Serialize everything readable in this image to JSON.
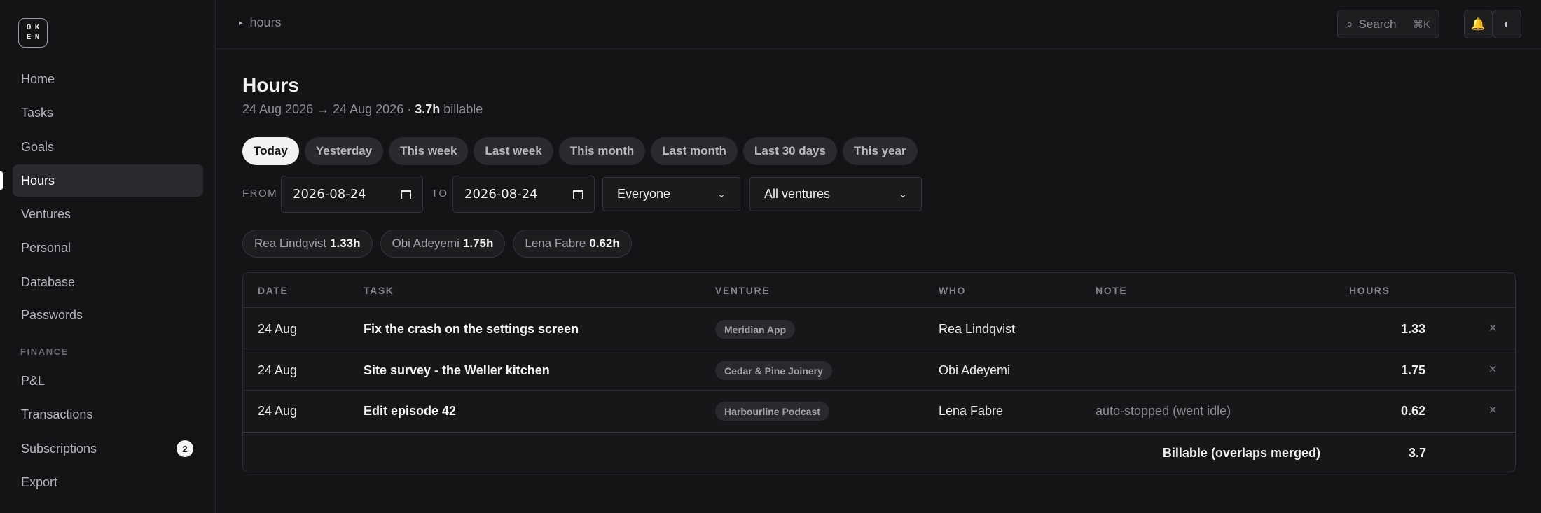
{
  "logo": {
    "letters": [
      "O",
      "K",
      "E",
      "N"
    ]
  },
  "sidebar": {
    "items": [
      {
        "label": "Home"
      },
      {
        "label": "Tasks"
      },
      {
        "label": "Goals"
      },
      {
        "label": "Hours",
        "active": true
      },
      {
        "label": "Ventures"
      },
      {
        "label": "Personal"
      },
      {
        "label": "Database"
      },
      {
        "label": "Passwords"
      }
    ],
    "finance_section": "FINANCE",
    "finance_items": [
      {
        "label": "P&L"
      },
      {
        "label": "Transactions"
      },
      {
        "label": "Subscriptions",
        "badge": "2"
      },
      {
        "label": "Export"
      }
    ]
  },
  "topbar": {
    "breadcrumb": "hours",
    "search_label": "Search",
    "search_shortcut": "⌘K",
    "bell_icon": "bell-icon",
    "theme_icon": "contrast-icon"
  },
  "page": {
    "title": "Hours",
    "range_text": "24 Aug 2026 → 24 Aug 2026 · ",
    "billable_value": "3.7h",
    "billable_suffix": " billable"
  },
  "quick_ranges": [
    "Today",
    "Yesterday",
    "This week",
    "Last week",
    "This month",
    "Last month",
    "Last 30 days",
    "This year"
  ],
  "active_range": "Today",
  "filters": {
    "from_label": "FROM",
    "from_value": "2026-08-24",
    "to_label": "TO",
    "to_value": "2026-08-24",
    "person_value": "Everyone",
    "venture_value": "All ventures"
  },
  "people_totals": [
    {
      "name": "Rea Lindqvist",
      "hours": "1.33h"
    },
    {
      "name": "Obi Adeyemi",
      "hours": "1.75h"
    },
    {
      "name": "Lena Fabre",
      "hours": "0.62h"
    }
  ],
  "table": {
    "headers": {
      "date": "DATE",
      "task": "TASK",
      "venture": "VENTURE",
      "who": "WHO",
      "note": "NOTE",
      "hours": "HOURS"
    },
    "rows": [
      {
        "date": "24 Aug",
        "task": "Fix the crash on the settings screen",
        "venture": "Meridian App",
        "who": "Rea Lindqvist",
        "note": "",
        "hours": "1.33"
      },
      {
        "date": "24 Aug",
        "task": "Site survey - the Weller kitchen",
        "venture": "Cedar & Pine Joinery",
        "who": "Obi Adeyemi",
        "note": "",
        "hours": "1.75"
      },
      {
        "date": "24 Aug",
        "task": "Edit episode 42",
        "venture": "Harbourline Podcast",
        "who": "Lena Fabre",
        "note": "auto-stopped (went idle)",
        "hours": "0.62"
      }
    ],
    "footer_label": "Billable (overlaps merged)",
    "footer_total": "3.7",
    "delete_glyph": "×"
  }
}
